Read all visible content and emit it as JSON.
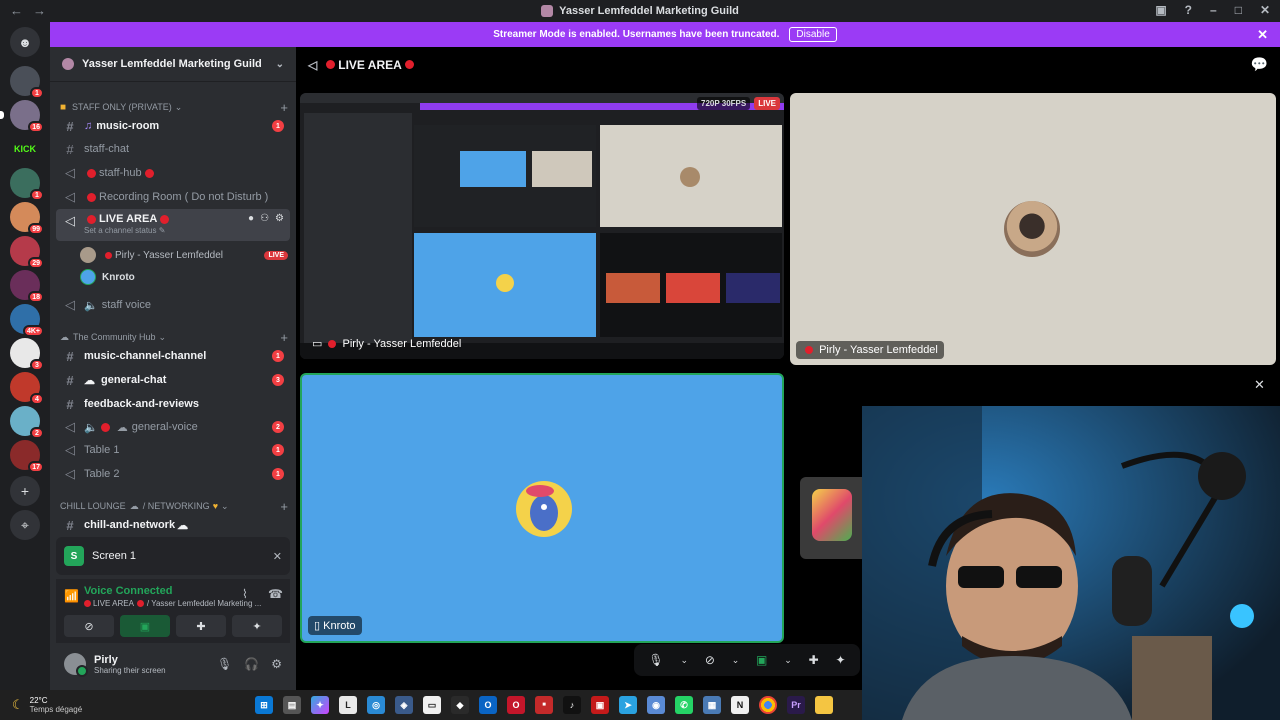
{
  "window": {
    "title": "Yasser Lemfeddel Marketing Guild"
  },
  "banner": {
    "text": "Streamer Mode is enabled. Usernames have been truncated.",
    "disable_label": "Disable"
  },
  "servers": [
    {
      "badge": "1",
      "color": "#4a4f58"
    },
    {
      "badge": "16",
      "color": "#7a6f8a",
      "selected": true
    },
    {
      "badge": "",
      "color": "#53fc18",
      "label": "KICK"
    },
    {
      "badge": "1",
      "color": "#3b6e5e"
    },
    {
      "badge": "99",
      "color": "#d48a5a"
    },
    {
      "badge": "29",
      "color": "#b53a4a"
    },
    {
      "badge": "18",
      "color": "#6a2e5a"
    },
    {
      "badge": "4K+",
      "color": "#2f6fa8"
    },
    {
      "badge": "3",
      "color": "#e8e8e8"
    },
    {
      "badge": "4",
      "color": "#c0392b"
    },
    {
      "badge": "2",
      "color": "#6ab0c8"
    },
    {
      "badge": "17",
      "color": "#8a2a2a"
    }
  ],
  "guild": {
    "name": "Yasser Lemfeddel Marketing Guild"
  },
  "categories": {
    "staff": "STAFF ONLY (PRIVATE)",
    "community": "The Community Hub",
    "lounge": "CHILL LOUNGE",
    "lounge_suffix": "/ NETWORKING"
  },
  "channels": {
    "music_room": {
      "name": "music-room",
      "mentions": "1"
    },
    "staff_chat": {
      "name": "staff-chat"
    },
    "staff_hub": {
      "name": "staff-hub"
    },
    "recording_room": {
      "name": "Recording Room ( Do not Disturb )"
    },
    "live_area": {
      "name": "LIVE AREA",
      "status": "Set a channel status"
    },
    "staff_voice": {
      "name": "staff voice"
    },
    "music_channel": {
      "name": "music-channel-channel",
      "mentions": "1"
    },
    "general_chat": {
      "name": "general-chat",
      "mentions": "3"
    },
    "feedback": {
      "name": "feedback-and-reviews"
    },
    "general_voice": {
      "name": "general-voice",
      "mentions": "2"
    },
    "table1": {
      "name": "Table 1",
      "mentions": "1"
    },
    "table2": {
      "name": "Table 2",
      "mentions": "1"
    },
    "chill_network": {
      "name": "chill-and-network"
    }
  },
  "voice_users": [
    {
      "name": "Pirly - Yasser Lemfeddel",
      "live": "LIVE"
    },
    {
      "name": "Knroto",
      "live": ""
    }
  ],
  "screen_card": {
    "label": "Screen 1"
  },
  "rtc": {
    "status": "Voice Connected",
    "channel": "LIVE AREA",
    "guild_trunc": "/ Yasser Lemfeddel Marketing ..."
  },
  "user": {
    "name": "Pirly",
    "status": "Sharing their screen"
  },
  "main": {
    "channel_title": "LIVE AREA",
    "stream_tile": {
      "label": "Pirly - Yasser Lemfeddel",
      "fps": "720P 30FPS",
      "live": "LIVE"
    },
    "camera_tile": {
      "label": "Pirly - Yasser Lemfeddel"
    },
    "knroto_tile": {
      "label": "Knroto"
    }
  },
  "taskbar": {
    "temp": "22°C",
    "weather": "Temps dégagé"
  },
  "colors": {
    "accent": "#9b3bf5",
    "live": "#da373c",
    "online": "#23a55a",
    "knroto_bg": "#4ea3e8"
  }
}
